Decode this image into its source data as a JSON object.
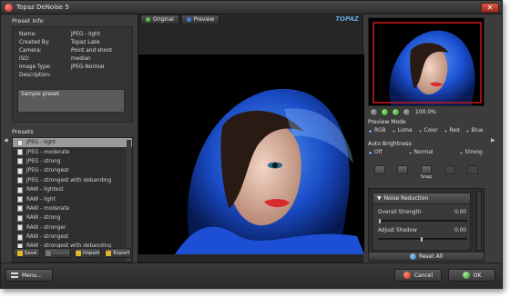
{
  "window": {
    "title": "Topaz DeNoise 5"
  },
  "preset_info": {
    "heading": "Preset Info",
    "rows": [
      {
        "label": "Name:",
        "value": "JPEG - light"
      },
      {
        "label": "Created By:",
        "value": "Topaz Labs"
      },
      {
        "label": "Camera:",
        "value": "Point and shoot"
      },
      {
        "label": "ISO:",
        "value": "median"
      },
      {
        "label": "Image Type:",
        "value": "JPEG-Normal"
      },
      {
        "label": "Description:",
        "value": ""
      }
    ],
    "description": "Sample preset"
  },
  "presets": {
    "heading": "Presets",
    "items": [
      "JPEG - light",
      "JPEG - moderate",
      "JPEG - strong",
      "JPEG - strongest",
      "JPEG - strongest with debanding",
      "RAW - lightest",
      "RAW - light",
      "RAW - moderate",
      "RAW - strong",
      "RAW - stronger",
      "RAW - strongest",
      "RAW - strongest with debanding"
    ],
    "selected_index": 0,
    "buttons": {
      "save": "Save",
      "delete": "Delete",
      "import": "Import",
      "export": "Export"
    }
  },
  "view_tabs": {
    "original": "Original",
    "preview": "Preview"
  },
  "logo_text": "TOPAZ",
  "zoom": {
    "level": "100.0%"
  },
  "preview_mode": {
    "label": "Preview Mode",
    "options": [
      "RGB",
      "Luma",
      "Color",
      "Red",
      "Blue"
    ],
    "selected": "RGB"
  },
  "auto_brightness": {
    "label": "Auto Brightness",
    "options": [
      "Off",
      "Normal",
      "Strong"
    ],
    "selected": "Off"
  },
  "tools": {
    "snap": "Snap"
  },
  "noise_reduction": {
    "heading": "Noise Reduction",
    "sliders": [
      {
        "label": "Overall Strength",
        "value": "0.00",
        "level": 0
      },
      {
        "label": "Adjust Shadow",
        "value": "0.00",
        "level": 0.5
      }
    ]
  },
  "reset_label": "Reset All",
  "bottom": {
    "menu": "Menu...",
    "cancel": "Cancel",
    "ok": "OK"
  },
  "colors": {
    "accent_blue": "#2f6fd6",
    "thumb_frame": "#d01818"
  }
}
